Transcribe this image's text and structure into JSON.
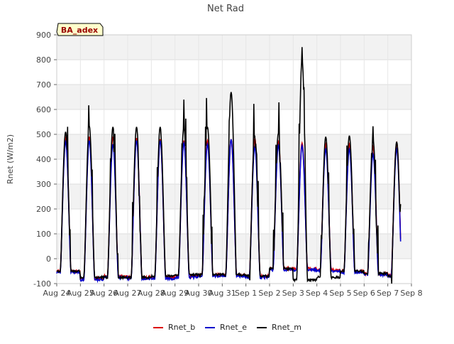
{
  "chart_data": {
    "type": "line",
    "title": "Net Rad",
    "ylabel": "Rnet (W/m2)",
    "xlabel": "",
    "site_label": "BA_adex",
    "ylim": [
      -100,
      900
    ],
    "yticks": [
      -100,
      0,
      100,
      200,
      300,
      400,
      500,
      600,
      700,
      800,
      900
    ],
    "xlim": [
      0,
      15
    ],
    "xticks": [
      0,
      1,
      2,
      3,
      4,
      5,
      6,
      7,
      8,
      9,
      10,
      11,
      12,
      13,
      14,
      15
    ],
    "xtick_labels": [
      "Aug 24",
      "Aug 25",
      "Aug 26",
      "Aug 27",
      "Aug 28",
      "Aug 29",
      "Aug 30",
      "Aug 31",
      "Sep 1",
      "Sep 2",
      "Sep 3",
      "Sep 4",
      "Sep 5",
      "Sep 6",
      "Sep 7",
      "Sep 8"
    ],
    "grid": true,
    "legend_position": "bottom",
    "days": [
      "Aug 24",
      "Aug 25",
      "Aug 26",
      "Aug 27",
      "Aug 28",
      "Aug 29",
      "Aug 30",
      "Aug 31",
      "Sep 1",
      "Sep 2",
      "Sep 3",
      "Sep 4",
      "Sep 5",
      "Sep 6",
      "Sep 7"
    ],
    "series": [
      {
        "name": "Rnet_b",
        "color": "#dd0000",
        "daily_peak": [
          485,
          490,
          490,
          485,
          480,
          475,
          475,
          480,
          485,
          470,
          465,
          460,
          460,
          450,
          465
        ],
        "daily_min": [
          -50,
          -80,
          -70,
          -75,
          -75,
          -70,
          -65,
          -65,
          -70,
          -40,
          -40,
          -45,
          -50,
          -60,
          -65
        ]
      },
      {
        "name": "Rnet_e",
        "color": "#0000cc",
        "daily_peak": [
          470,
          475,
          460,
          475,
          475,
          465,
          460,
          480,
          450,
          455,
          455,
          440,
          440,
          420,
          440
        ],
        "daily_min": [
          -55,
          -85,
          -75,
          -80,
          -80,
          -75,
          -70,
          -70,
          -75,
          -45,
          -45,
          -50,
          -55,
          -65,
          -70
        ]
      },
      {
        "name": "Rnet_m",
        "color": "#000000",
        "daily_peak": [
          510,
          535,
          530,
          530,
          530,
          530,
          530,
          670,
          495,
          505,
          800,
          490,
          495,
          480,
          470
        ],
        "daily_min": [
          -50,
          -75,
          -75,
          -75,
          -70,
          -65,
          -65,
          -65,
          -70,
          -40,
          -85,
          -75,
          -50,
          -60,
          -70
        ]
      }
    ]
  }
}
